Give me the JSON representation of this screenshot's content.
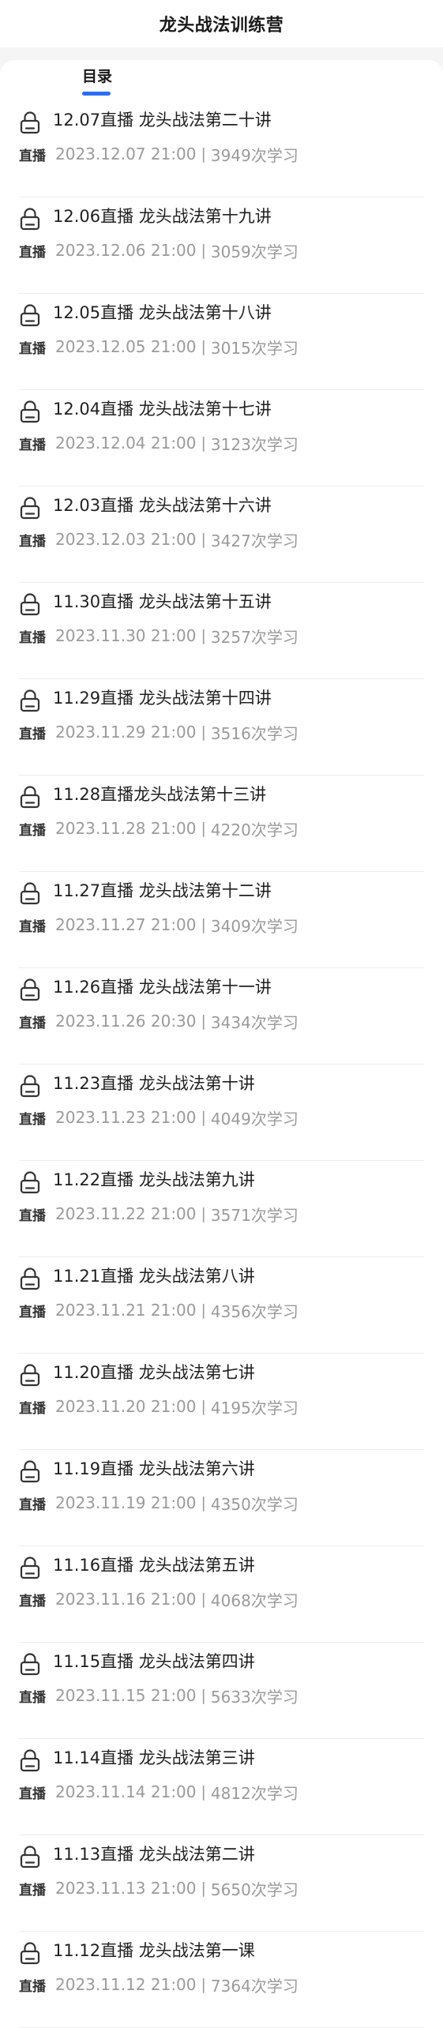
{
  "header": {
    "title": "龙头战法训练营"
  },
  "tabs": [
    {
      "label": "目录"
    }
  ],
  "lessons": [
    {
      "title": "12.07直播 龙头战法第二十讲",
      "type": "直播",
      "time": "2023.12.07 21:00",
      "views": "3949次学习"
    },
    {
      "title": "12.06直播 龙头战法第十九讲",
      "type": "直播",
      "time": "2023.12.06 21:00",
      "views": "3059次学习"
    },
    {
      "title": "12.05直播 龙头战法第十八讲",
      "type": "直播",
      "time": "2023.12.05 21:00",
      "views": "3015次学习"
    },
    {
      "title": "12.04直播 龙头战法第十七讲",
      "type": "直播",
      "time": "2023.12.04 21:00",
      "views": "3123次学习"
    },
    {
      "title": "12.03直播 龙头战法第十六讲",
      "type": "直播",
      "time": "2023.12.03 21:00",
      "views": "3427次学习"
    },
    {
      "title": "11.30直播 龙头战法第十五讲",
      "type": "直播",
      "time": "2023.11.30 21:00",
      "views": "3257次学习"
    },
    {
      "title": "11.29直播 龙头战法第十四讲",
      "type": "直播",
      "time": "2023.11.29 21:00",
      "views": "3516次学习"
    },
    {
      "title": "11.28直播龙头战法第十三讲",
      "type": "直播",
      "time": "2023.11.28 21:00",
      "views": "4220次学习"
    },
    {
      "title": "11.27直播 龙头战法第十二讲",
      "type": "直播",
      "time": "2023.11.27 21:00",
      "views": "3409次学习"
    },
    {
      "title": "11.26直播 龙头战法第十一讲",
      "type": "直播",
      "time": "2023.11.26 20:30",
      "views": "3434次学习"
    },
    {
      "title": "11.23直播 龙头战法第十讲",
      "type": "直播",
      "time": "2023.11.23 21:00",
      "views": "4049次学习"
    },
    {
      "title": "11.22直播 龙头战法第九讲",
      "type": "直播",
      "time": "2023.11.22 21:00",
      "views": "3571次学习"
    },
    {
      "title": "11.21直播 龙头战法第八讲",
      "type": "直播",
      "time": "2023.11.21 21:00",
      "views": "4356次学习"
    },
    {
      "title": "11.20直播 龙头战法第七讲",
      "type": "直播",
      "time": "2023.11.20 21:00",
      "views": "4195次学习"
    },
    {
      "title": "11.19直播 龙头战法第六讲",
      "type": "直播",
      "time": "2023.11.19 21:00",
      "views": "4350次学习"
    },
    {
      "title": "11.16直播 龙头战法第五讲",
      "type": "直播",
      "time": "2023.11.16 21:00",
      "views": "4068次学习"
    },
    {
      "title": "11.15直播 龙头战法第四讲",
      "type": "直播",
      "time": "2023.11.15 21:00",
      "views": "5633次学习"
    },
    {
      "title": "11.14直播 龙头战法第三讲",
      "type": "直播",
      "time": "2023.11.14 21:00",
      "views": "4812次学习"
    },
    {
      "title": "11.13直播 龙头战法第二讲",
      "type": "直播",
      "time": "2023.11.13 21:00",
      "views": "5650次学习"
    },
    {
      "title": "11.12直播 龙头战法第一课",
      "type": "直播",
      "time": "2023.11.12 21:00",
      "views": "7364次学习"
    }
  ],
  "meta_separator": "|",
  "icons": {
    "lesson_lock": "lock-icon"
  },
  "colors": {
    "accent": "#2a6df5",
    "meta_text": "#9a9a9a",
    "title_text": "#1f1f1f"
  }
}
